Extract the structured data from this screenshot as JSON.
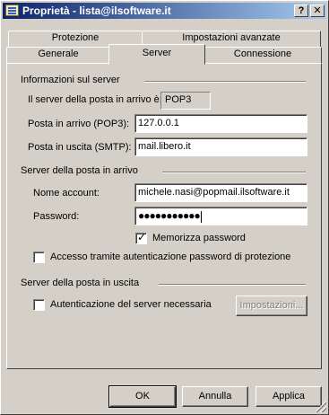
{
  "window": {
    "title": "Proprietà - lista@ilsoftware.it",
    "help_label": "?",
    "close_label": "✕"
  },
  "tabs": {
    "row_back": [
      {
        "label": "Protezione"
      },
      {
        "label": "Impostazioni avanzate"
      }
    ],
    "row_front": [
      {
        "label": "Generale"
      },
      {
        "label": "Server",
        "selected": true
      },
      {
        "label": "Connessione"
      }
    ]
  },
  "server_info": {
    "heading": "Informazioni sul server",
    "incoming_type_label": "Il server della posta in arrivo è:",
    "incoming_type_value": "POP3",
    "incoming_label": "Posta in arrivo (POP3):",
    "incoming_value": "127.0.0.1",
    "outgoing_label": "Posta in uscita (SMTP):",
    "outgoing_value": "mail.libero.it"
  },
  "incoming_server": {
    "heading": "Server della posta in arrivo",
    "account_label": "Nome account:",
    "account_value": "michele.nasi@popmail.ilsoftware.it",
    "password_label": "Password:",
    "password_mask": "●●●●●●●●●●●",
    "remember_label": "Memorizza password",
    "remember_checked": true,
    "spa_label": "Accesso tramite autenticazione password di protezione",
    "spa_checked": false
  },
  "outgoing_server": {
    "heading": "Server della posta in uscita",
    "auth_label": "Autenticazione del server necessaria",
    "auth_checked": false,
    "settings_label": "Impostazioni..."
  },
  "footer": {
    "ok_label": "OK",
    "cancel_label": "Annulla",
    "apply_label": "Applica"
  },
  "colors": {
    "face": "#d4d0c8",
    "titlebar_start": "#0a246a",
    "titlebar_end": "#a6caf0"
  }
}
